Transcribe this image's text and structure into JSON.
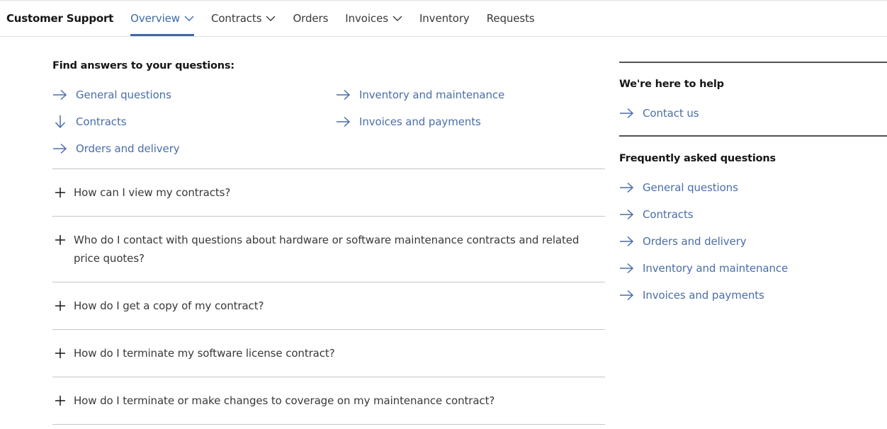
{
  "nav": {
    "brand": "Customer Support",
    "items": [
      {
        "label": "Overview",
        "has_dropdown": true,
        "active": true
      },
      {
        "label": "Contracts",
        "has_dropdown": true,
        "active": false
      },
      {
        "label": "Orders",
        "has_dropdown": false,
        "active": false
      },
      {
        "label": "Invoices",
        "has_dropdown": true,
        "active": false
      },
      {
        "label": "Inventory",
        "has_dropdown": false,
        "active": false
      },
      {
        "label": "Requests",
        "has_dropdown": false,
        "active": false
      }
    ]
  },
  "main": {
    "find_title": "Find answers to your questions:",
    "quick_links": [
      {
        "label": "General questions",
        "icon": "arrow-right-icon"
      },
      {
        "label": "Contracts",
        "icon": "arrow-down-icon"
      },
      {
        "label": "Orders and delivery",
        "icon": "arrow-right-icon"
      },
      {
        "label": "Inventory and maintenance",
        "icon": "arrow-right-icon"
      },
      {
        "label": "Invoices and payments",
        "icon": "arrow-right-icon"
      }
    ],
    "faq": [
      {
        "question": "How can I view my contracts?",
        "icon": "plus-icon"
      },
      {
        "question": "Who do I contact with questions about hardware or software maintenance contracts and related price quotes?",
        "icon": "plus-icon"
      },
      {
        "question": "How do I get a copy of my contract?",
        "icon": "plus-icon"
      },
      {
        "question": "How do I terminate my software license contract?",
        "icon": "plus-icon"
      },
      {
        "question": "How do I terminate or make changes to coverage on my maintenance contract?",
        "icon": "plus-icon"
      }
    ]
  },
  "aside": {
    "help_title": "We're here to help",
    "help_links": [
      {
        "label": "Contact us",
        "icon": "arrow-right-icon"
      }
    ],
    "faq_title": "Frequently asked questions",
    "faq_links": [
      {
        "label": "General questions",
        "icon": "arrow-right-icon"
      },
      {
        "label": "Contracts",
        "icon": "arrow-right-icon"
      },
      {
        "label": "Orders and delivery",
        "icon": "arrow-right-icon"
      },
      {
        "label": "Inventory and maintenance",
        "icon": "arrow-right-icon"
      },
      {
        "label": "Invoices and payments",
        "icon": "arrow-right-icon"
      }
    ]
  },
  "colors": {
    "link": "#4a6ea9",
    "active_nav": "#3f6aa6",
    "text": "#161616",
    "divider": "#c6c6c6",
    "aside_rule": "#525252"
  }
}
